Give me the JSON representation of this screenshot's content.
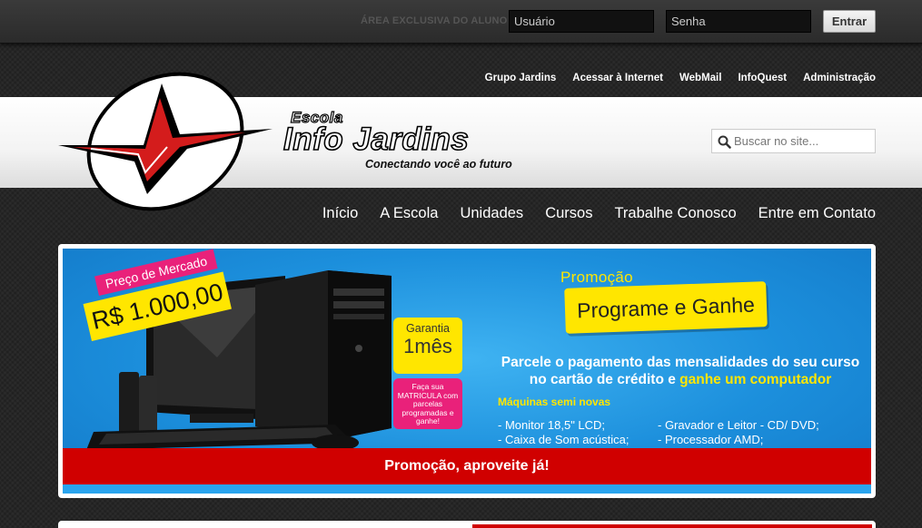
{
  "login": {
    "area_label": "ÁREA EXCLUSIVA DO ALUNO",
    "username_placeholder": "Usuário",
    "password_placeholder": "Senha",
    "submit_label": "Entrar"
  },
  "util_nav": {
    "items": [
      "Grupo Jardins",
      "Acessar à Internet",
      "WebMail",
      "InfoQuest",
      "Administração"
    ]
  },
  "brand": {
    "escola": "Escola",
    "name": "Info Jardins",
    "tagline": "Conectando você ao futuro"
  },
  "search": {
    "placeholder": "Buscar no site..."
  },
  "main_nav": {
    "items": [
      "Início",
      "A Escola",
      "Unidades",
      "Cursos",
      "Trabalhe Conosco",
      "Entre em Contato"
    ]
  },
  "banner": {
    "preco_label": "Preço de Mercado",
    "preco_value": "R$ 1.000,00",
    "garantia_label": "Garantia",
    "garantia_value": "1mês",
    "matricula_text": "Faça sua MATRICULA com parcelas programadas e ganhe!",
    "promo_small": "Promoção",
    "promo_title": "Programe e Ganhe",
    "desc_line1": "Parcele o pagamento das mensalidades do seu curso",
    "desc_line2_a": "no cartão de crédito e ",
    "desc_line2_b": "ganhe um computador",
    "maquinas_title": "Máquinas semi novas",
    "specs": [
      "- Monitor 18,5\" LCD;",
      "- Gravador e Leitor - CD/ DVD;",
      "- Caixa de Som acústica;",
      "- Processador AMD;"
    ],
    "bar_text": "Promoção, aproveite já!"
  },
  "colors": {
    "accent_red": "#d00000",
    "promo_yellow": "#ffe600",
    "promo_pink": "#e9217a",
    "banner_blue": "#1c8fdc"
  }
}
